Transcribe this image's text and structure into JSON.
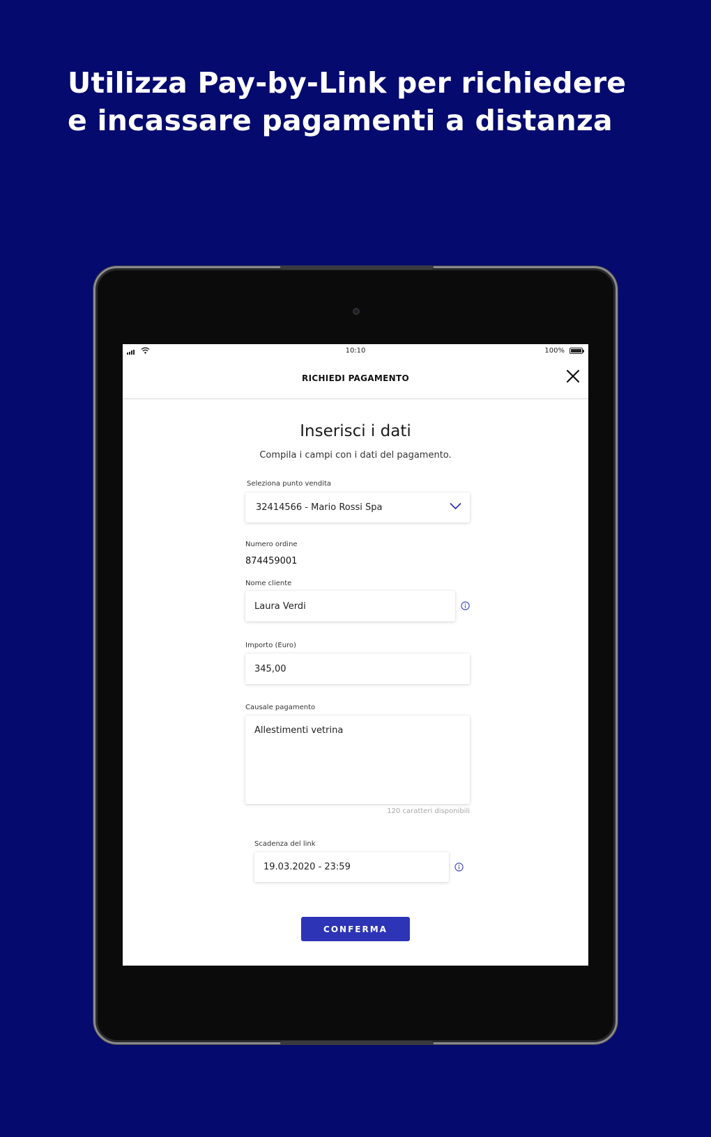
{
  "headline": {
    "line1": "Utilizza Pay-by-Link per richiedere",
    "line2": "e incassare pagamenti a distanza"
  },
  "status_bar": {
    "time": "10:10",
    "battery": "100%"
  },
  "nav": {
    "title": "RICHIEDI PAGAMENTO",
    "close_icon": "close-icon"
  },
  "form": {
    "title": "Inserisci i dati",
    "subtitle": "Compila i campi con i dati del pagamento.",
    "store": {
      "label": "Seleziona punto vendita",
      "value": "32414566 - Mario Rossi Spa"
    },
    "order": {
      "label": "Numero ordine",
      "value": "874459001"
    },
    "customer": {
      "label": "Nome cliente",
      "value": "Laura Verdi"
    },
    "amount": {
      "label": "Importo (Euro)",
      "value": "345,00"
    },
    "reason": {
      "label": "Causale pagamento",
      "value": "Allestimenti vetrina",
      "counter": "120 caratteri disponibili"
    },
    "expiry": {
      "label": "Scadenza del link",
      "value": "19.03.2020 - 23:59"
    },
    "confirm_label": "CONFERMA"
  },
  "colors": {
    "background": "#050a6e",
    "accent": "#2d34b6",
    "info_icon": "#3a43b8"
  }
}
